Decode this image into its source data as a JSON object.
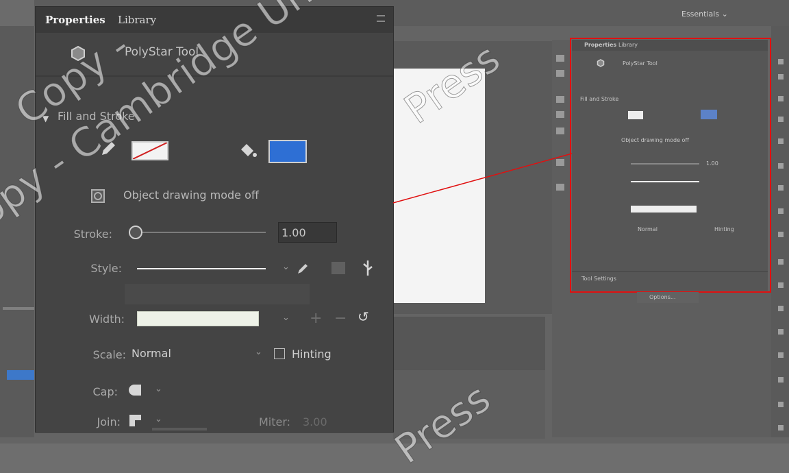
{
  "window": {
    "workspace": "Essentials"
  },
  "panel": {
    "tabs": [
      "Properties",
      "Library"
    ],
    "tool": {
      "name": "PolyStar Tool",
      "icon": "polystar-icon"
    },
    "section": "Fill and Stroke",
    "object_drawing": "Object drawing mode off",
    "stroke": {
      "label": "Stroke:",
      "value": "1.00"
    },
    "style": {
      "label": "Style:"
    },
    "width": {
      "label": "Width:"
    },
    "scale": {
      "label": "Scale:",
      "value": "Normal",
      "hinting": "Hinting"
    },
    "cap": {
      "label": "Cap:"
    },
    "join": {
      "label": "Join:"
    },
    "miter": {
      "label": "Miter:",
      "value": "3.00"
    },
    "fill_color": "#2e6fd4"
  },
  "mini": {
    "tabs": [
      "Properties",
      "Library"
    ],
    "tool": "PolyStar Tool",
    "section": "Fill and Stroke",
    "object_drawing": "Object drawing mode off",
    "stroke_value": "1.00",
    "scale_value": "Normal",
    "hinting": "Hinting",
    "tool_settings": "Tool Settings",
    "options_button": "Options..."
  },
  "colors": {
    "highlight": "#e01010",
    "accent": "#2e6fd4"
  },
  "watermark": [
    "Copy - Cambridge University Press - Review Copy",
    "Press",
    "Copy -",
    "Press"
  ]
}
